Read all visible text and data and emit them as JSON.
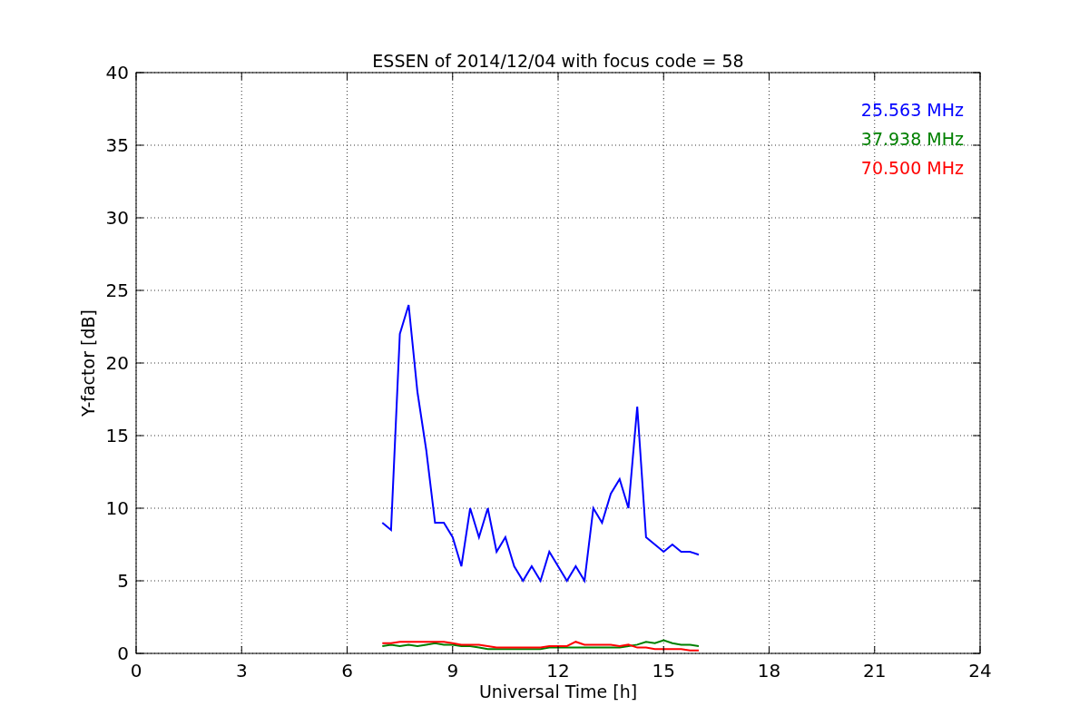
{
  "figure": {
    "chart_data": {
      "type": "line",
      "title": "ESSEN of 2014/12/04 with focus code = 58",
      "xlabel": "Universal Time [h]",
      "ylabel": "Y-factor [dB]",
      "x": [
        7,
        7.25,
        7.5,
        7.75,
        8,
        8.25,
        8.5,
        8.75,
        9,
        9.25,
        9.5,
        9.75,
        10,
        10.25,
        10.5,
        10.75,
        11,
        11.25,
        11.5,
        11.75,
        12,
        12.25,
        12.5,
        12.75,
        13,
        13.25,
        13.5,
        13.75,
        14,
        14.25,
        14.5,
        14.75,
        15,
        15.25,
        15.5,
        15.75,
        16
      ],
      "series": [
        {
          "name": "25.563 MHz",
          "color": "#0000ff",
          "values": [
            9,
            8.5,
            22,
            24,
            18,
            14,
            9,
            9,
            8,
            6,
            10,
            8,
            10,
            7,
            8,
            6,
            5,
            6,
            5,
            7,
            6,
            5,
            6,
            5,
            10,
            9,
            11,
            12,
            10,
            17,
            8,
            7.5,
            7,
            7.5,
            7,
            7,
            6.8
          ]
        },
        {
          "name": "37.938 MHz",
          "color": "#008000",
          "values": [
            0.5,
            0.6,
            0.5,
            0.6,
            0.5,
            0.6,
            0.7,
            0.6,
            0.6,
            0.5,
            0.5,
            0.4,
            0.3,
            0.3,
            0.3,
            0.3,
            0.3,
            0.3,
            0.3,
            0.4,
            0.4,
            0.4,
            0.4,
            0.4,
            0.4,
            0.4,
            0.4,
            0.4,
            0.5,
            0.6,
            0.8,
            0.7,
            0.9,
            0.7,
            0.6,
            0.6,
            0.5
          ]
        },
        {
          "name": "70.500 MHz",
          "color": "#ff0000",
          "values": [
            0.7,
            0.7,
            0.8,
            0.8,
            0.8,
            0.8,
            0.8,
            0.8,
            0.7,
            0.6,
            0.6,
            0.6,
            0.5,
            0.4,
            0.4,
            0.4,
            0.4,
            0.4,
            0.4,
            0.5,
            0.5,
            0.5,
            0.8,
            0.6,
            0.6,
            0.6,
            0.6,
            0.5,
            0.6,
            0.4,
            0.4,
            0.3,
            0.3,
            0.3,
            0.3,
            0.2,
            0.2
          ]
        }
      ],
      "grid": true,
      "xlim": [
        0,
        24
      ],
      "ylim": [
        0,
        40
      ],
      "xticks": [
        0,
        3,
        6,
        9,
        12,
        15,
        18,
        21,
        24
      ],
      "yticks": [
        0,
        5,
        10,
        15,
        20,
        25,
        30,
        35,
        40
      ]
    }
  }
}
